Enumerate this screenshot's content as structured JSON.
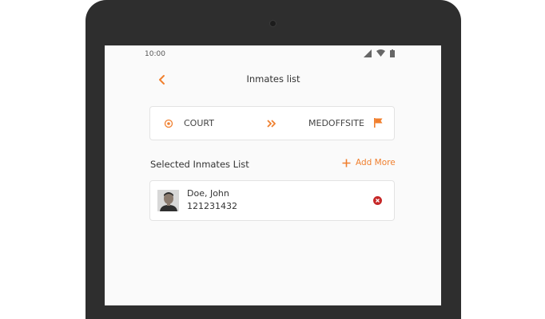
{
  "status_bar": {
    "time": "10:00"
  },
  "header": {
    "title": "Inmates list"
  },
  "route": {
    "from": "COURT",
    "to": "MEDOFFSITE"
  },
  "selected_section": {
    "title": "Selected Inmates List",
    "add_more_label": "Add More"
  },
  "inmates": [
    {
      "name": "Doe, John",
      "id": "121231432"
    }
  ],
  "colors": {
    "accent": "#f07f2e",
    "danger": "#c62828",
    "bezel": "#2e2e2e"
  }
}
